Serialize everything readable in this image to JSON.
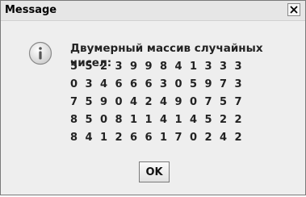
{
  "window": {
    "title": "Message",
    "close_symbol": "x"
  },
  "message": {
    "heading": "Двумерный массив случайных чисел:",
    "rows": [
      [
        "5",
        "5",
        "2",
        "3",
        "9",
        "9",
        "8",
        "4",
        "1",
        "3",
        "3",
        "3"
      ],
      [
        "0",
        "3",
        "4",
        "6",
        "6",
        "6",
        "3",
        "0",
        "5",
        "9",
        "7",
        "3"
      ],
      [
        "7",
        "5",
        "9",
        "0",
        "4",
        "2",
        "4",
        "9",
        "0",
        "7",
        "5",
        "7"
      ],
      [
        "8",
        "5",
        "0",
        "8",
        "1",
        "1",
        "4",
        "1",
        "4",
        "5",
        "2",
        "2"
      ],
      [
        "8",
        "4",
        "1",
        "2",
        "6",
        "6",
        "1",
        "7",
        "0",
        "2",
        "4",
        "2"
      ]
    ]
  },
  "buttons": {
    "ok_label": "OK"
  },
  "icons": {
    "dialog_icon": "info-icon",
    "close": "close-icon"
  }
}
